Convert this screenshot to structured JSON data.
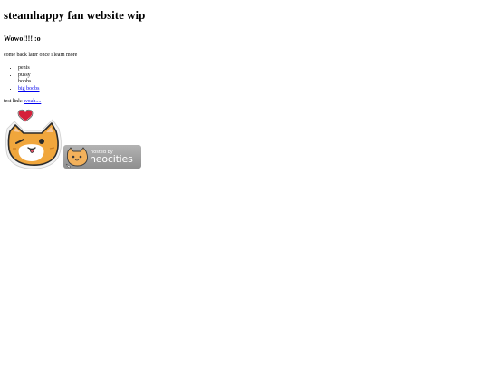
{
  "page": {
    "title": "steamhappy fan website wip",
    "subheading": "Wowo!!!! :o",
    "intro": "come back later once i learn more"
  },
  "list_items": [
    {
      "label": "penis",
      "is_link": false
    },
    {
      "label": "pussy",
      "is_link": false
    },
    {
      "label": "boobs",
      "is_link": false
    },
    {
      "label": "big boobs",
      "is_link": true
    }
  ],
  "test_link": {
    "prefix": "test link: ",
    "label": "woah...."
  },
  "badge": {
    "small_text": "hosted by",
    "large_text": "neocities"
  },
  "colors": {
    "link": "#0000ee",
    "cat_orange": "#f0a63c",
    "heart": "#d5203a",
    "badge_gray": "#a0a0a0"
  },
  "icons": {
    "sticker": "orange-cat-with-heart-sticker",
    "badge": "neocities-cat-icon"
  }
}
